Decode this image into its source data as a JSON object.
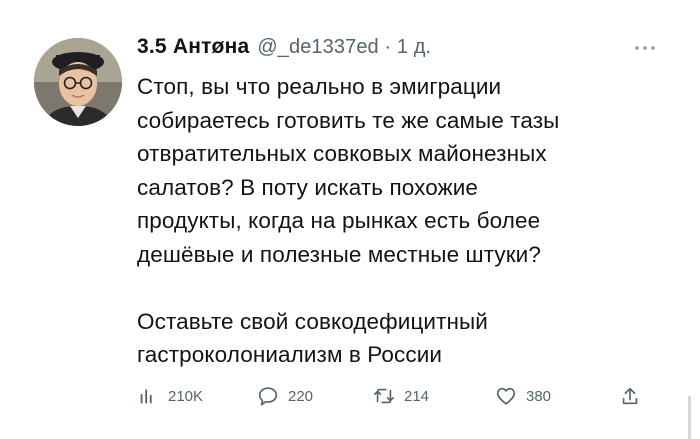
{
  "tweet": {
    "author_name": "3.5 Антøна",
    "handle_time": "@_de1337ed · 1 д.",
    "paragraphs": [
      [
        "Стоп, вы что реально в эмиграции",
        "собираетесь готовить те же самые тазы",
        "отвратительных совковых майонезных",
        "салатов? В поту искать похожие",
        "продукты, когда на рынках есть более",
        "дешёвые и полезные местные штуки?"
      ],
      [
        "Оставьте свой совкодефицитный",
        "гастроколониализм в России"
      ]
    ]
  },
  "actions": {
    "views": "210K",
    "replies": "220",
    "retweets": "214",
    "likes": "380"
  },
  "icons": {
    "more": "more-horizontal-icon",
    "views": "bar-chart-icon",
    "replies": "reply-bubble-icon",
    "retweets": "retweet-icon",
    "likes": "heart-icon",
    "share": "share-icon"
  },
  "colors": {
    "text": "#0f1419",
    "muted": "#536471"
  }
}
